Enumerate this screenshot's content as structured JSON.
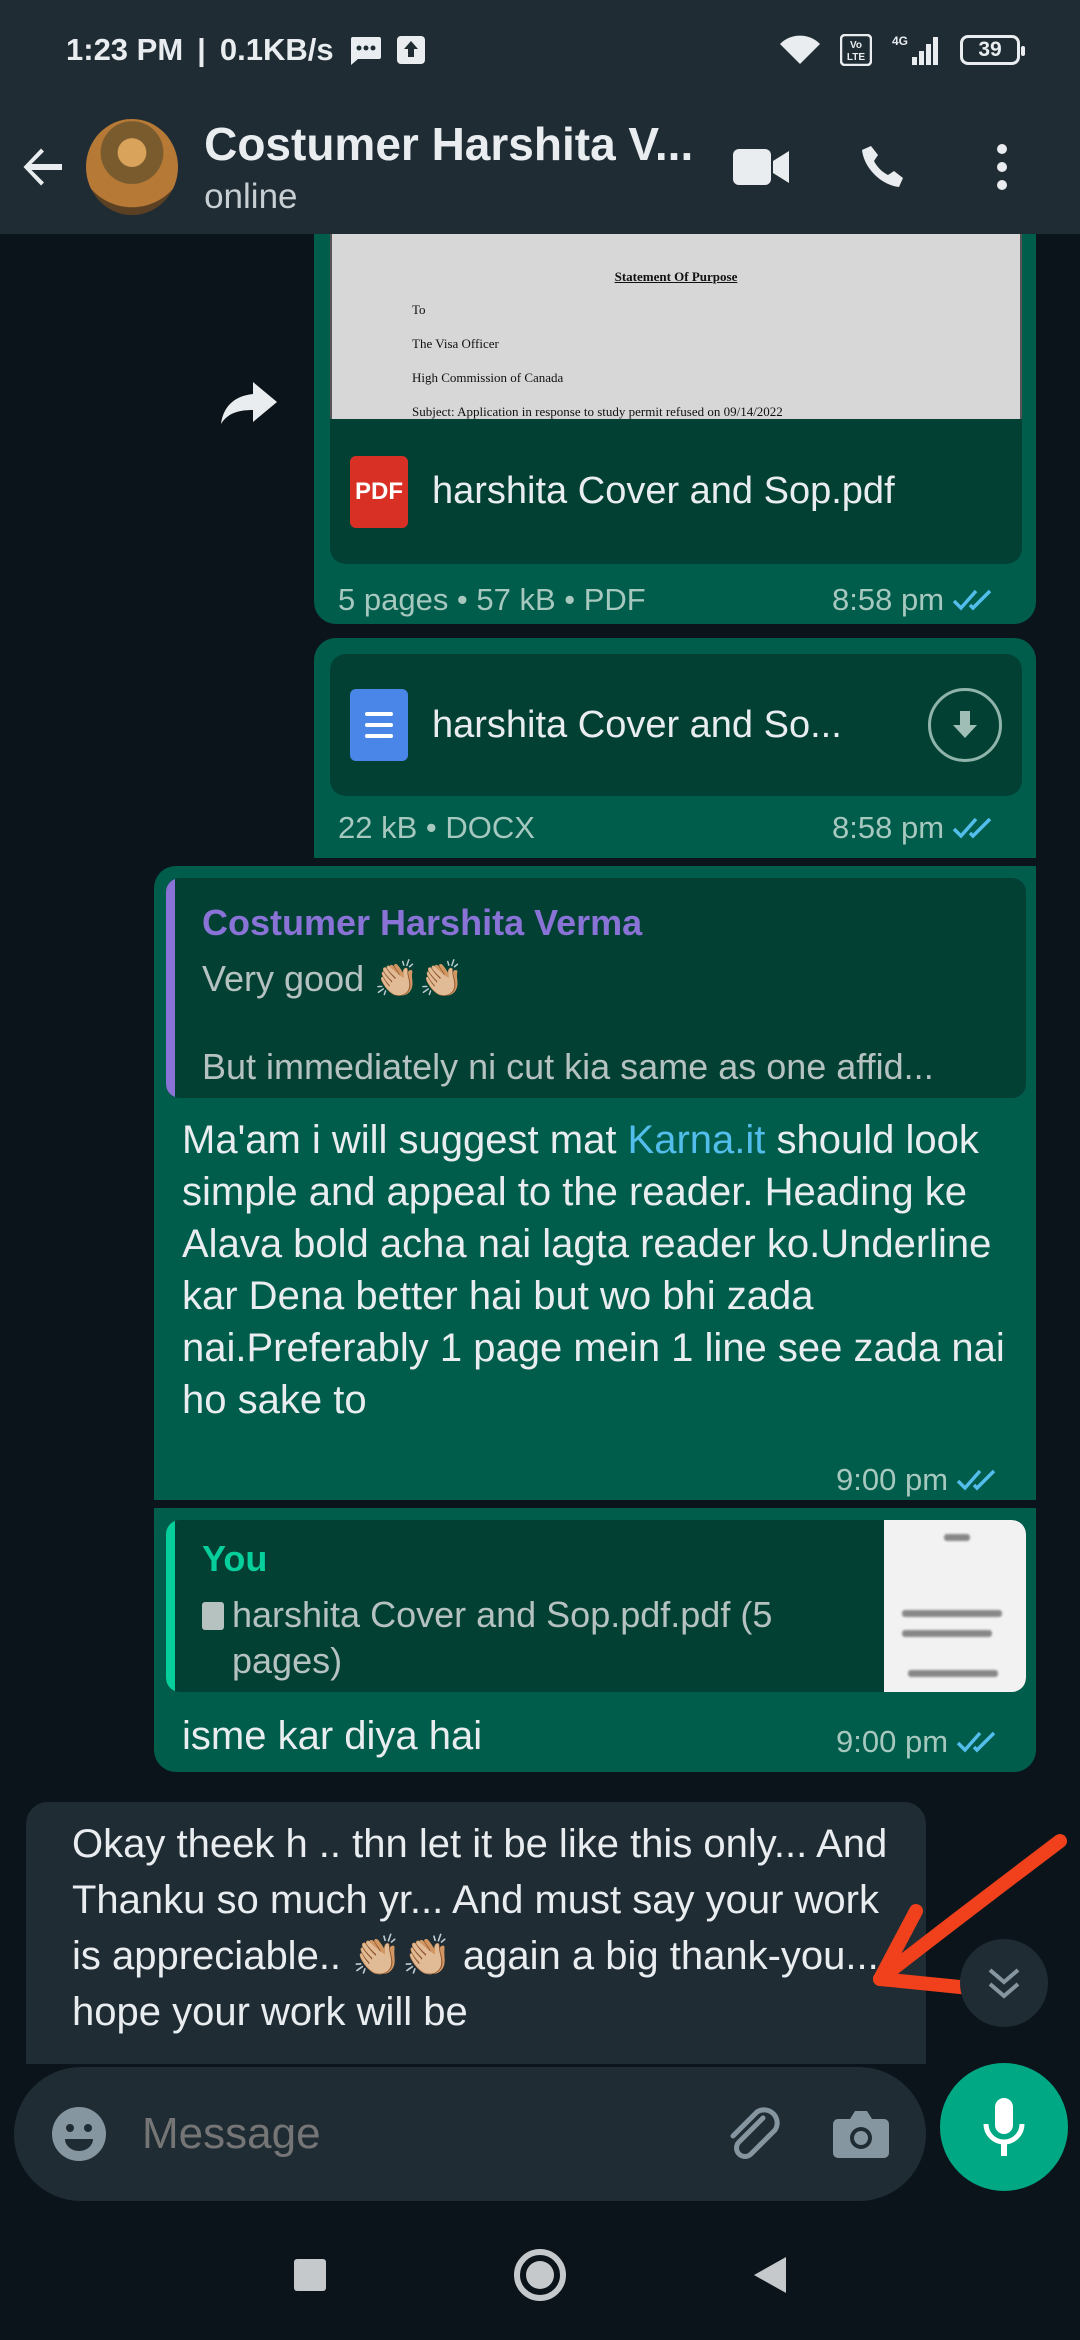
{
  "status_bar": {
    "time": "1:23 PM",
    "separator": "|",
    "speed": "0.1KB/s",
    "volte": "Vo LTE",
    "network": "4G",
    "battery": "39"
  },
  "header": {
    "contact_name": "Costumer Harshita V...",
    "status": "online"
  },
  "messages": {
    "pdf_message": {
      "preview_title": "Statement Of Purpose",
      "preview_lines": [
        "To",
        "The Visa Officer",
        "High Commission of Canada",
        "Subject: Application in response to study permit refused on 09/14/2022"
      ],
      "file_icon_label": "PDF",
      "file_name": "harshita Cover and Sop.pdf",
      "meta": "5 pages • 57 kB • PDF",
      "time": "8:58 pm"
    },
    "docx_message": {
      "file_name": "harshita Cover and So...",
      "meta": "22 kB • DOCX",
      "time": "8:58 pm"
    },
    "reply_message": {
      "quoted_name": "Costumer Harshita Verma",
      "quoted_line1": "Very good 👏🏼👏🏼",
      "quoted_line2": "But immediately ni cut kia same as one affid...",
      "text_before_link": "Ma'am i will suggest mat ",
      "link_text": "Karna.it",
      "text_after_link": " should look simple and appeal to the reader. Heading ke Alava bold acha nai lagta reader ko.Underline kar Dena better hai but wo bhi zada nai.Preferably 1 page mein 1 line see zada nai ho sake to",
      "time": "9:00 pm"
    },
    "self_reply_message": {
      "quoted_name": "You",
      "quoted_file": "harshita Cover and Sop.pdf.pdf (5 pages)",
      "text": "isme kar diya hai",
      "time": "9:00 pm"
    },
    "incoming_message": {
      "text": "Okay theek h .. thn let it be like this only... And Thanku so much yr... And must say your work is appreciable.. 👏🏼👏🏼 again a big thank-you... I hope your work will be"
    }
  },
  "composer": {
    "placeholder": "Message"
  },
  "colors": {
    "outgoing_bubble": "#005c4b",
    "incoming_bubble": "#1f2c34",
    "accent_green": "#00a884",
    "read_ticks": "#53bdeb",
    "quote_bar_other": "#8a73d6",
    "quote_bar_you": "#06cf9c",
    "annotation_arrow": "#f0411c"
  }
}
